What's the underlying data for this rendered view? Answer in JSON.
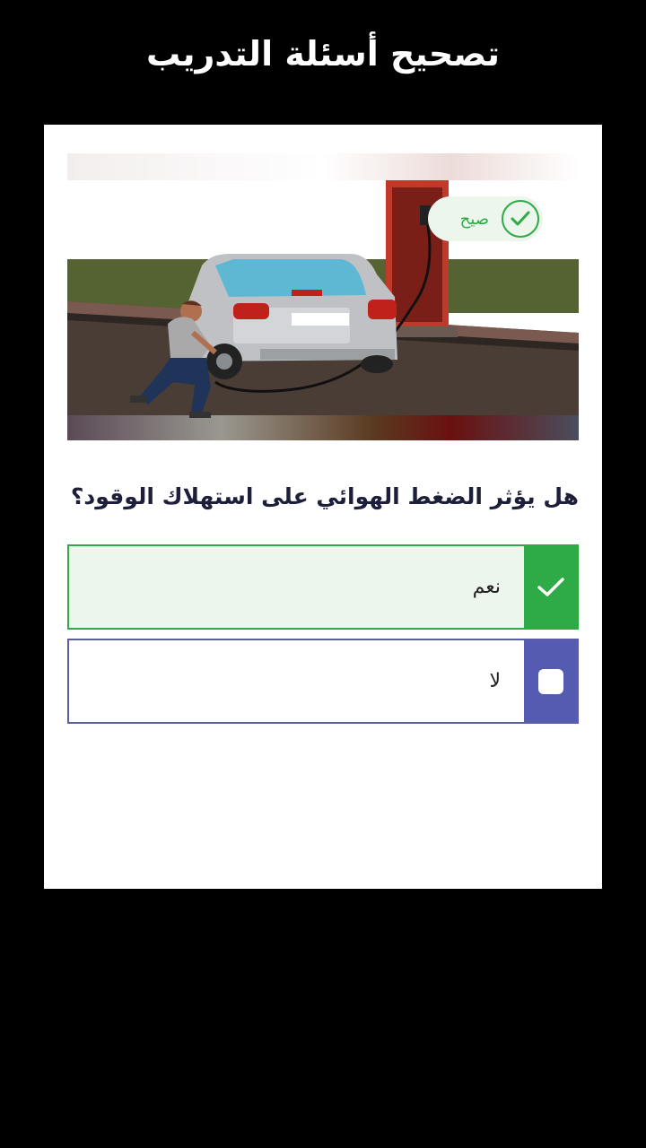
{
  "header": {
    "title": "تصحيح أسئلة التدريب"
  },
  "result": {
    "label": "صيح",
    "icon": "check-circle-icon",
    "color": "#2eaa47"
  },
  "question": {
    "text": "هل يؤثر الضغط الهوائي على استهلاك الوقود؟"
  },
  "options": [
    {
      "label": "نعم",
      "state": "correct",
      "icon": "check-icon",
      "color": "#2eaa47"
    },
    {
      "label": "لا",
      "state": "unselected",
      "icon": "checkbox-empty-icon",
      "color": "#565bb2"
    }
  ],
  "illustration": {
    "subject": "man-inflating-car-tire-at-air-pump"
  }
}
